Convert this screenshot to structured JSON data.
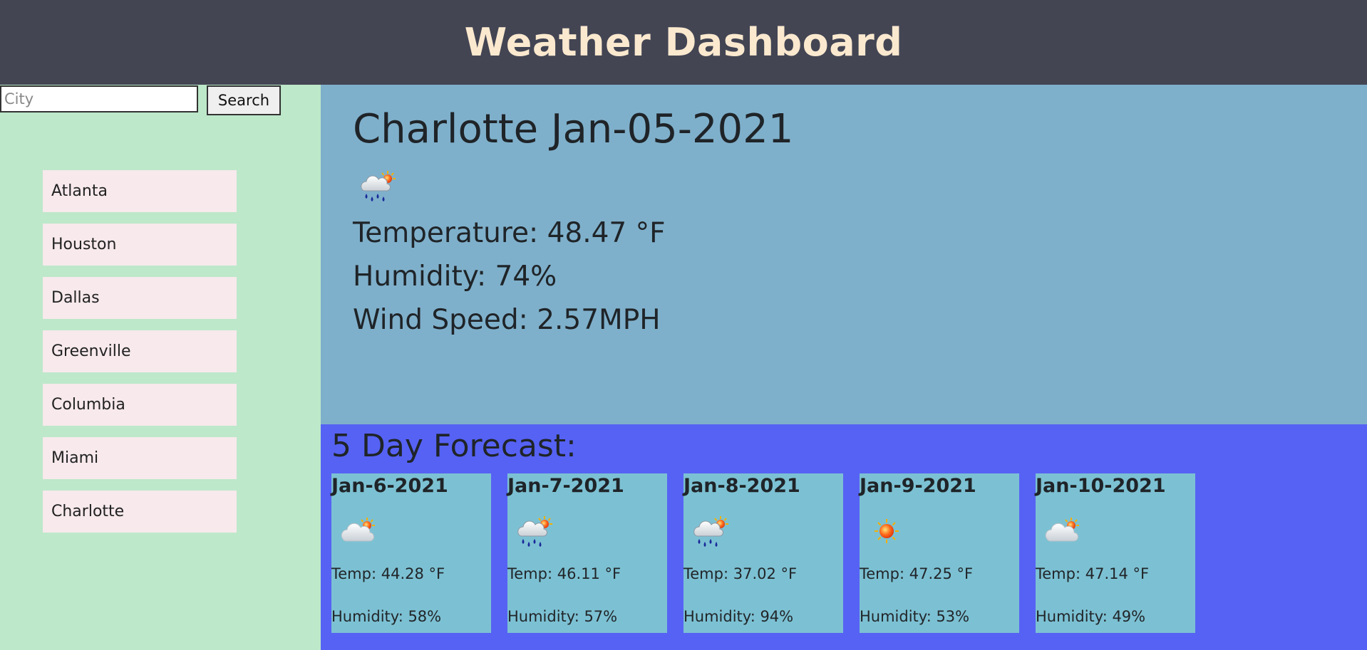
{
  "header": {
    "title": "Weather Dashboard"
  },
  "search": {
    "placeholder": "City",
    "value": "",
    "button_label": "Search"
  },
  "history": {
    "cities": [
      "Atlanta",
      "Houston",
      "Dallas",
      "Greenville",
      "Columbia",
      "Miami",
      "Charlotte"
    ]
  },
  "current": {
    "heading": "Charlotte Jan-05-2021",
    "icon": "rain-cloud-sun-icon",
    "temperature": "Temperature: 48.47 °F",
    "humidity": "Humidity: 74%",
    "wind": "Wind Speed: 2.57MPH"
  },
  "forecast": {
    "title": "5 Day Forecast:",
    "days": [
      {
        "date": "Jan-6-2021",
        "icon": "cloud-sun-icon",
        "temp": "Temp: 44.28 °F",
        "humidity": "Humidity: 58%"
      },
      {
        "date": "Jan-7-2021",
        "icon": "rain-cloud-sun-icon",
        "temp": "Temp: 46.11 °F",
        "humidity": "Humidity: 57%"
      },
      {
        "date": "Jan-8-2021",
        "icon": "rain-cloud-sun-icon",
        "temp": "Temp: 37.02 °F",
        "humidity": "Humidity: 94%"
      },
      {
        "date": "Jan-9-2021",
        "icon": "sun-icon",
        "temp": "Temp: 47.25 °F",
        "humidity": "Humidity: 53%"
      },
      {
        "date": "Jan-10-2021",
        "icon": "cloud-sun-icon",
        "temp": "Temp: 47.14 °F",
        "humidity": "Humidity: 49%"
      }
    ]
  },
  "colors": {
    "header_bg": "#434553",
    "title_text": "#fbe9cf",
    "sidebar_bg": "#bde8ca",
    "city_item_bg": "#f7e9ec",
    "current_bg": "#7fb0cb",
    "forecast_bg": "#5662f4",
    "card_bg": "#7cc1d3"
  }
}
